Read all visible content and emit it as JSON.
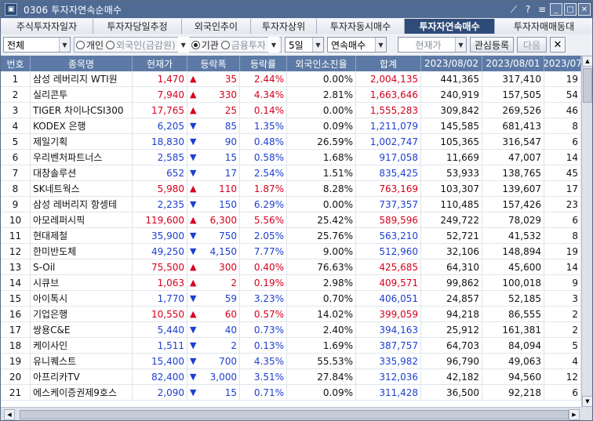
{
  "window": {
    "title": "0306 투자자연속순매수"
  },
  "tabs": [
    "주식투자자일자",
    "투자자당일추정",
    "외국인추이",
    "투자자상위",
    "투자자동시매수",
    "투자자연속매수",
    "투자자매매동대"
  ],
  "active_tab_index": 5,
  "toolbar": {
    "market": "전체",
    "radios": [
      "개인",
      "외국인(금감원)",
      "기관",
      "금융투자"
    ],
    "selected_radio": "기관",
    "period": "5일",
    "mode": "연속매수",
    "sort": "현재가",
    "lookup_label": "관심등록",
    "next_label": "다음",
    "close_label": "✕"
  },
  "columns": [
    "번호",
    "종목명",
    "현재가",
    "등락폭",
    "등락률",
    "외국인소진율",
    "합계",
    "2023/08/02",
    "2023/08/01",
    "2023/07"
  ],
  "rows": [
    {
      "no": "1",
      "name": "삼성 레버리지 WTI원",
      "price": "1,470",
      "dir": "up",
      "chg": "35",
      "rate": "2.44%",
      "foreign": "0.00%",
      "sum": "2,004,135",
      "d1": "441,365",
      "d2": "317,410",
      "d3": "19"
    },
    {
      "no": "2",
      "name": "실리콘투",
      "price": "7,940",
      "dir": "up",
      "chg": "330",
      "rate": "4.34%",
      "foreign": "2.81%",
      "sum": "1,663,646",
      "d1": "240,919",
      "d2": "157,505",
      "d3": "54"
    },
    {
      "no": "3",
      "name": "TIGER 차이나CSI300",
      "price": "17,765",
      "dir": "up",
      "chg": "25",
      "rate": "0.14%",
      "foreign": "0.00%",
      "sum": "1,555,283",
      "d1": "309,842",
      "d2": "269,526",
      "d3": "46"
    },
    {
      "no": "4",
      "name": "KODEX 은행",
      "price": "6,205",
      "dir": "down",
      "chg": "85",
      "rate": "1.35%",
      "foreign": "0.09%",
      "sum": "1,211,079",
      "d1": "145,585",
      "d2": "681,413",
      "d3": "8"
    },
    {
      "no": "5",
      "name": "제일기획",
      "price": "18,830",
      "dir": "down",
      "chg": "90",
      "rate": "0.48%",
      "foreign": "26.59%",
      "sum": "1,002,747",
      "d1": "105,365",
      "d2": "316,547",
      "d3": "6"
    },
    {
      "no": "6",
      "name": "우리벤처파트너스",
      "price": "2,585",
      "dir": "down",
      "chg": "15",
      "rate": "0.58%",
      "foreign": "1.68%",
      "sum": "917,058",
      "d1": "11,669",
      "d2": "47,007",
      "d3": "14"
    },
    {
      "no": "7",
      "name": "대창솔루션",
      "price": "652",
      "dir": "down",
      "chg": "17",
      "rate": "2.54%",
      "foreign": "1.51%",
      "sum": "835,425",
      "d1": "53,933",
      "d2": "138,765",
      "d3": "45"
    },
    {
      "no": "8",
      "name": "SK네트웍스",
      "price": "5,980",
      "dir": "up",
      "chg": "110",
      "rate": "1.87%",
      "foreign": "8.28%",
      "sum": "763,169",
      "d1": "103,307",
      "d2": "139,607",
      "d3": "17"
    },
    {
      "no": "9",
      "name": "삼성 레버리지 항셍테",
      "price": "2,235",
      "dir": "down",
      "chg": "150",
      "rate": "6.29%",
      "foreign": "0.00%",
      "sum": "737,357",
      "d1": "110,485",
      "d2": "157,426",
      "d3": "23"
    },
    {
      "no": "10",
      "name": "아모레퍼시픽",
      "price": "119,600",
      "dir": "up",
      "chg": "6,300",
      "rate": "5.56%",
      "foreign": "25.42%",
      "sum": "589,596",
      "d1": "249,722",
      "d2": "78,029",
      "d3": "6"
    },
    {
      "no": "11",
      "name": "현대제철",
      "price": "35,900",
      "dir": "down",
      "chg": "750",
      "rate": "2.05%",
      "foreign": "25.76%",
      "sum": "563,210",
      "d1": "52,721",
      "d2": "41,532",
      "d3": "8"
    },
    {
      "no": "12",
      "name": "한미반도체",
      "price": "49,250",
      "dir": "down",
      "chg": "4,150",
      "rate": "7.77%",
      "foreign": "9.00%",
      "sum": "512,960",
      "d1": "32,106",
      "d2": "148,894",
      "d3": "19"
    },
    {
      "no": "13",
      "name": "S-Oil",
      "price": "75,500",
      "dir": "up",
      "chg": "300",
      "rate": "0.40%",
      "foreign": "76.63%",
      "sum": "425,685",
      "d1": "64,310",
      "d2": "45,600",
      "d3": "14"
    },
    {
      "no": "14",
      "name": "시큐브",
      "price": "1,063",
      "dir": "up",
      "chg": "2",
      "rate": "0.19%",
      "foreign": "2.98%",
      "sum": "409,571",
      "d1": "99,862",
      "d2": "100,018",
      "d3": "9"
    },
    {
      "no": "15",
      "name": "아이톡시",
      "price": "1,770",
      "dir": "down",
      "chg": "59",
      "rate": "3.23%",
      "foreign": "0.70%",
      "sum": "406,051",
      "d1": "24,857",
      "d2": "52,185",
      "d3": "3"
    },
    {
      "no": "16",
      "name": "기업은행",
      "price": "10,550",
      "dir": "up",
      "chg": "60",
      "rate": "0.57%",
      "foreign": "14.02%",
      "sum": "399,059",
      "d1": "94,218",
      "d2": "86,555",
      "d3": "2"
    },
    {
      "no": "17",
      "name": "쌍용C&E",
      "price": "5,440",
      "dir": "down",
      "chg": "40",
      "rate": "0.73%",
      "foreign": "2.40%",
      "sum": "394,163",
      "d1": "25,912",
      "d2": "161,381",
      "d3": "2"
    },
    {
      "no": "18",
      "name": "케이사인",
      "price": "1,511",
      "dir": "down",
      "chg": "2",
      "rate": "0.13%",
      "foreign": "1.69%",
      "sum": "387,757",
      "d1": "64,703",
      "d2": "84,094",
      "d3": "5"
    },
    {
      "no": "19",
      "name": "유니퀘스트",
      "price": "15,400",
      "dir": "down",
      "chg": "700",
      "rate": "4.35%",
      "foreign": "55.53%",
      "sum": "335,982",
      "d1": "96,790",
      "d2": "49,063",
      "d3": "4"
    },
    {
      "no": "20",
      "name": "아프리카TV",
      "price": "82,400",
      "dir": "down",
      "chg": "3,000",
      "rate": "3.51%",
      "foreign": "27.84%",
      "sum": "312,036",
      "d1": "42,182",
      "d2": "94,560",
      "d3": "12"
    },
    {
      "no": "21",
      "name": "에스케이증권제9호스",
      "price": "2,090",
      "dir": "down",
      "chg": "15",
      "rate": "0.71%",
      "foreign": "0.09%",
      "sum": "311,428",
      "d1": "36,500",
      "d2": "92,218",
      "d3": "6"
    }
  ]
}
